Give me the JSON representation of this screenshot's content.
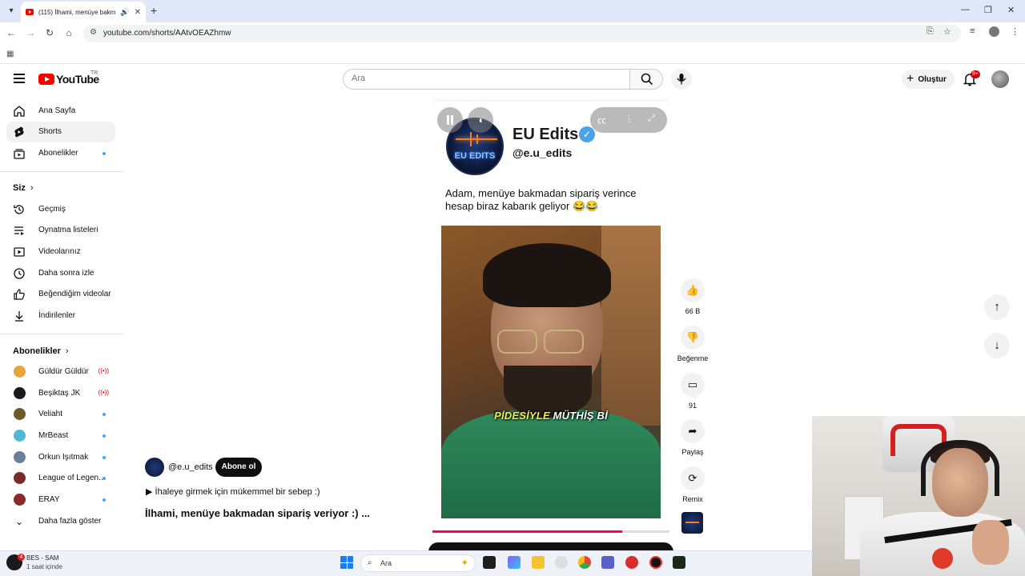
{
  "browser": {
    "tab_title": "(115) İlhami, menüye bakm...",
    "url": "youtube.com/shorts/AAtvOEAZhmw"
  },
  "header": {
    "logo_text": "YouTube",
    "region": "TR",
    "search_placeholder": "Ara",
    "create_label": "Oluştur",
    "notification_badge": "9+"
  },
  "sidebar": {
    "main": [
      {
        "label": "Ana Sayfa",
        "icon": "home-icon"
      },
      {
        "label": "Shorts",
        "icon": "shorts-icon"
      },
      {
        "label": "Abonelikler",
        "icon": "subscriptions-icon"
      }
    ],
    "you_heading": "Siz",
    "you": [
      {
        "label": "Geçmiş",
        "icon": "history-icon"
      },
      {
        "label": "Oynatma listeleri",
        "icon": "playlists-icon"
      },
      {
        "label": "Videolarınız",
        "icon": "your-videos-icon"
      },
      {
        "label": "Daha sonra izle",
        "icon": "watch-later-icon"
      },
      {
        "label": "Beğendiğim videolar",
        "icon": "liked-icon"
      },
      {
        "label": "İndirilenler",
        "icon": "downloads-icon"
      }
    ],
    "subs_heading": "Abonelikler",
    "subs": [
      {
        "label": "Güldür Güldür",
        "status": "live",
        "color": "#e8a43a"
      },
      {
        "label": "Beşiktaş JK",
        "status": "live",
        "color": "#1a1a1a"
      },
      {
        "label": "Veliaht",
        "status": "new",
        "color": "#6b5a2a"
      },
      {
        "label": "MrBeast",
        "status": "new",
        "color": "#4fb8d8"
      },
      {
        "label": "Orkun Işıtmak",
        "status": "new",
        "color": "#6a7f99"
      },
      {
        "label": "League of Legen...",
        "status": "new",
        "color": "#7a2a2a"
      },
      {
        "label": "ERAY",
        "status": "new",
        "color": "#8a2a2a"
      }
    ],
    "show_more": "Daha fazla göster"
  },
  "short": {
    "channel_name": "EU Edits",
    "channel_handle": "@e.u_edits",
    "logo_text": "EU EDITS",
    "caption": "Adam, menüye bakmadan sipariş verince hesap biraz kabarık geliyor 😂😂",
    "subtitle_part1": "PİDESİYLE ",
    "subtitle_part2": "MÜTHİŞ Bİ",
    "progress": 0.8
  },
  "actions": {
    "likes": "66 B",
    "dislike": "Beğenme",
    "comments": "91",
    "share": "Paylaş",
    "remix": "Remix"
  },
  "meta": {
    "handle": "@e.u_edits",
    "subscribe": "Abone ol",
    "description": "▶ İhaleye girmek için mükemmel bir sebep :)",
    "title": "İlhami, menüye bakmadan sipariş veriyor :) ..."
  },
  "taskbar": {
    "notif_count": "4",
    "game_title": "BES - SAM",
    "game_time": "1 saat içinde",
    "search_placeholder": "Ara"
  }
}
